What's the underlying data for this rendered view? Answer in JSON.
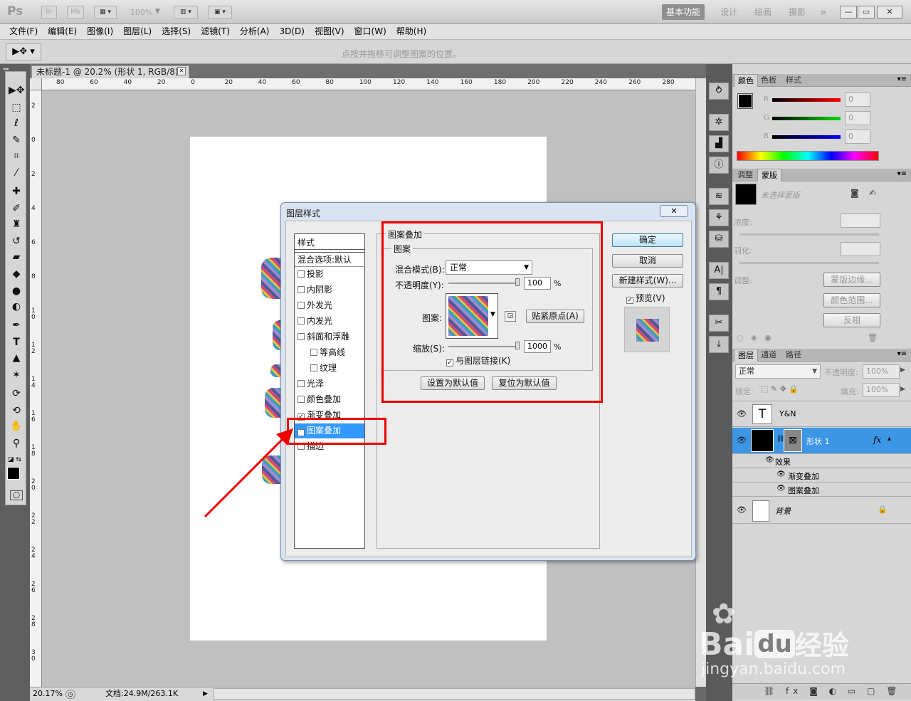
{
  "app": {
    "logo": "Ps",
    "br": "Br",
    "mb": "Mb",
    "zoom": "100%"
  },
  "workspace": {
    "items": [
      "基本功能",
      "设计",
      "绘画",
      "摄影"
    ],
    "more": "»"
  },
  "window_controls": {
    "min": "—",
    "restore": "▭",
    "close": "✕"
  },
  "menu": [
    "文件(F)",
    "编辑(E)",
    "图像(I)",
    "图层(L)",
    "选择(S)",
    "滤镜(T)",
    "分析(A)",
    "3D(D)",
    "视图(V)",
    "窗口(W)",
    "帮助(H)"
  ],
  "options": {
    "hint": "点按并拖移可调整图案的位置。"
  },
  "document": {
    "tab_title": "未标题-1 @ 20.2% (形状 1, RGB/8) *",
    "close": "✕"
  },
  "ruler": {
    "h_labels": [
      "80",
      "60",
      "40",
      "20",
      "0",
      "20",
      "40",
      "60",
      "80",
      "100",
      "120",
      "140",
      "160",
      "180",
      "200",
      "220",
      "240",
      "260",
      "280"
    ],
    "v_labels": [
      "2",
      "0",
      "2",
      "4",
      "6",
      "8",
      "1 0",
      "1 2",
      "1 4",
      "1 6",
      "1 8",
      "2 0",
      "2 2",
      "2 4",
      "2 6",
      "2 8",
      "3 0"
    ]
  },
  "status": {
    "zoom": "20.17%",
    "doc": "文档:24.9M/263.1K"
  },
  "color_panel": {
    "tabs": [
      "颜色",
      "色板",
      "样式"
    ],
    "r_label": "R",
    "g_label": "G",
    "b_label": "B",
    "r": "0",
    "g": "0",
    "b": "0"
  },
  "mask_panel": {
    "tabs": [
      "调整",
      "蒙版"
    ],
    "none_selected": "未选择蒙版",
    "density": "浓度:",
    "feather": "羽化:",
    "adjust": "调整:",
    "mask_edge": "蒙版边缘...",
    "color_range": "颜色范围...",
    "invert": "反相"
  },
  "layers_panel": {
    "tabs": [
      "图层",
      "通道",
      "路径"
    ],
    "blend": "正常",
    "opacity_label": "不透明度:",
    "opacity": "100%",
    "lock_label": "锁定:",
    "fill_label": "填充:",
    "fill": "100%",
    "layers": [
      {
        "name": "Y&N",
        "type": "text"
      },
      {
        "name": "形状 1",
        "type": "shape",
        "fx": "fx"
      },
      {
        "name": "背景",
        "type": "background"
      }
    ],
    "effects_label": "效果",
    "effects": [
      "渐变叠加",
      "图案叠加"
    ]
  },
  "dialog": {
    "title": "图层样式",
    "close": "✕",
    "styles_header": "样式",
    "blend_options": "混合选项:默认",
    "styles": [
      {
        "label": "投影",
        "checked": false
      },
      {
        "label": "内阴影",
        "checked": false
      },
      {
        "label": "外发光",
        "checked": false
      },
      {
        "label": "内发光",
        "checked": false
      },
      {
        "label": "斜面和浮雕",
        "checked": false
      },
      {
        "label": "等高线",
        "checked": false
      },
      {
        "label": "纹理",
        "checked": false
      },
      {
        "label": "光泽",
        "checked": false
      },
      {
        "label": "颜色叠加",
        "checked": false
      },
      {
        "label": "渐变叠加",
        "checked": true
      },
      {
        "label": "图案叠加",
        "checked": true
      },
      {
        "label": "描边",
        "checked": false
      }
    ],
    "section_title": "图案叠加",
    "group_title": "图案",
    "blend_mode_label": "混合模式(B):",
    "blend_mode": "正常",
    "opacity_label": "不透明度(Y):",
    "opacity": "100",
    "pct": "%",
    "pattern_label": "图案:",
    "snap_btn": "贴紧原点(A)",
    "scale_label": "缩放(S):",
    "scale": "1000",
    "link_label": "与图层链接(K)",
    "link_checked": true,
    "set_default": "设置为默认值",
    "reset_default": "复位为默认值",
    "ok": "确定",
    "cancel": "取消",
    "new_style": "新建样式(W)...",
    "preview": "预览(V)",
    "preview_checked": true
  },
  "watermark": {
    "brand": "Bai",
    "brand2": "du",
    "cn": "经验",
    "url": "jingyan.baidu.com"
  },
  "colors": {
    "accent_red": "#e00000",
    "selection_blue": "#3399ff",
    "layer_sel": "#3d95e6"
  }
}
